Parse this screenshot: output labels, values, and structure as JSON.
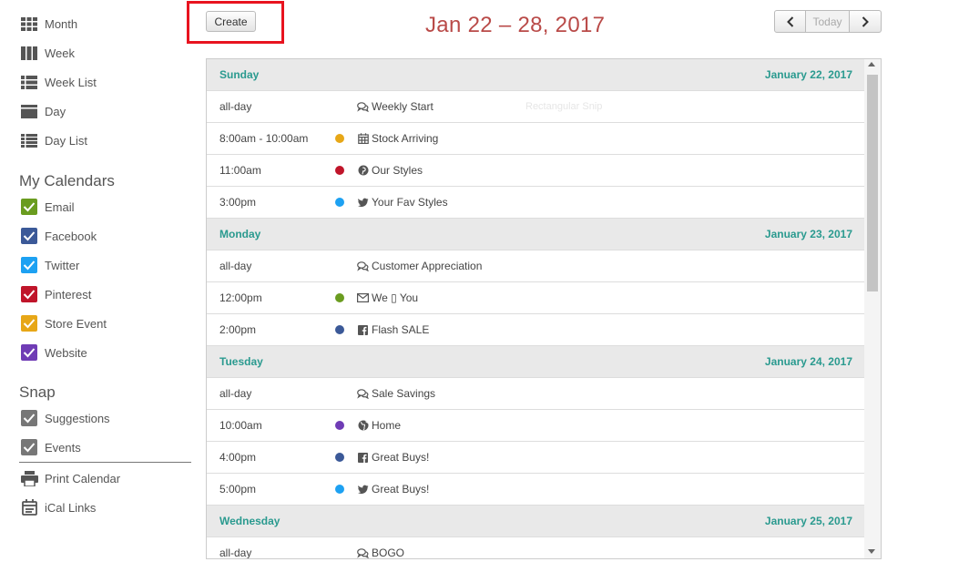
{
  "sidebar": {
    "views": [
      {
        "label": "Month",
        "icon": "month-grid-icon"
      },
      {
        "label": "Week",
        "icon": "week-columns-icon"
      },
      {
        "label": "Week List",
        "icon": "week-list-icon"
      },
      {
        "label": "Day",
        "icon": "day-icon"
      },
      {
        "label": "Day List",
        "icon": "day-list-icon"
      }
    ],
    "my_calendars_title": "My Calendars",
    "calendars": [
      {
        "label": "Email",
        "color": "#6a9c1f"
      },
      {
        "label": "Facebook",
        "color": "#3b5998"
      },
      {
        "label": "Twitter",
        "color": "#1da1f2"
      },
      {
        "label": "Pinterest",
        "color": "#c0152a"
      },
      {
        "label": "Store Event",
        "color": "#e7a717"
      },
      {
        "label": "Website",
        "color": "#6f3cb5"
      }
    ],
    "snap_title": "Snap",
    "snap_items": [
      {
        "label": "Suggestions",
        "color": "#777777"
      },
      {
        "label": "Events",
        "color": "#777777"
      }
    ],
    "tools": [
      {
        "label": "Print Calendar",
        "icon": "printer-icon"
      },
      {
        "label": "iCal Links",
        "icon": "calendar-icon"
      }
    ]
  },
  "header": {
    "create_label": "Create",
    "range_title": "Jan 22 – 28, 2017",
    "today_label": "Today"
  },
  "days": [
    {
      "name": "Sunday",
      "date": "January 22, 2017",
      "events": [
        {
          "time": "all-day",
          "dot": null,
          "icon": "comments-icon",
          "title": "Weekly Start",
          "ghost": "Rectangular Snip"
        },
        {
          "time": "8:00am - 10:00am",
          "dot": "#e7a717",
          "icon": "calendar-icon",
          "title": "Stock Arriving"
        },
        {
          "time": "11:00am",
          "dot": "#c0152a",
          "icon": "pinterest-icon",
          "title": "Our Styles"
        },
        {
          "time": "3:00pm",
          "dot": "#1da1f2",
          "icon": "twitter-icon",
          "title": "Your Fav Styles"
        }
      ]
    },
    {
      "name": "Monday",
      "date": "January 23, 2017",
      "events": [
        {
          "time": "all-day",
          "dot": null,
          "icon": "comments-icon",
          "title": "Customer Appreciation"
        },
        {
          "time": "12:00pm",
          "dot": "#6a9c1f",
          "icon": "envelope-icon",
          "title": "We ▯ You"
        },
        {
          "time": "2:00pm",
          "dot": "#3b5998",
          "icon": "facebook-icon",
          "title": "Flash SALE"
        }
      ]
    },
    {
      "name": "Tuesday",
      "date": "January 24, 2017",
      "events": [
        {
          "time": "all-day",
          "dot": null,
          "icon": "comments-icon",
          "title": "Sale Savings"
        },
        {
          "time": "10:00am",
          "dot": "#6f3cb5",
          "icon": "globe-icon",
          "title": "Home"
        },
        {
          "time": "4:00pm",
          "dot": "#3b5998",
          "icon": "facebook-icon",
          "title": "Great Buys!"
        },
        {
          "time": "5:00pm",
          "dot": "#1da1f2",
          "icon": "twitter-icon",
          "title": "Great Buys!"
        }
      ]
    },
    {
      "name": "Wednesday",
      "date": "January 25, 2017",
      "events": [
        {
          "time": "all-day",
          "dot": null,
          "icon": "comments-icon",
          "title": "BOGO"
        }
      ]
    }
  ]
}
